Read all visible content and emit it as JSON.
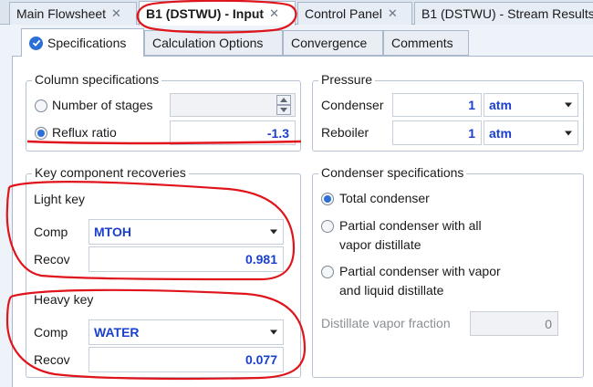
{
  "doc_tabs": [
    {
      "label": "Main Flowsheet",
      "active": false
    },
    {
      "label": "B1 (DSTWU) - Input",
      "active": true
    },
    {
      "label": "Control Panel",
      "active": false
    },
    {
      "label": "B1 (DSTWU) - Stream Results",
      "active": false
    }
  ],
  "close_glyph": "✕",
  "form_tabs": [
    {
      "label": "Specifications",
      "active": true,
      "icon": "check-circle-icon"
    },
    {
      "label": "Calculation Options",
      "active": false
    },
    {
      "label": "Convergence",
      "active": false
    },
    {
      "label": "Comments",
      "active": false
    }
  ],
  "column_specs": {
    "title": "Column specifications",
    "number_of_stages": {
      "label": "Number of stages",
      "selected": false,
      "value": ""
    },
    "reflux_ratio": {
      "label": "Reflux ratio",
      "selected": true,
      "value": "-1.3"
    }
  },
  "pressure": {
    "title": "Pressure",
    "condenser": {
      "label": "Condenser",
      "value": "1",
      "unit": "atm"
    },
    "reboiler": {
      "label": "Reboiler",
      "value": "1",
      "unit": "atm"
    }
  },
  "key_recoveries": {
    "title": "Key component recoveries",
    "light_key": {
      "title": "Light key",
      "comp_label": "Comp",
      "comp": "MTOH",
      "recov_label": "Recov",
      "recov": "0.981"
    },
    "heavy_key": {
      "title": "Heavy key",
      "comp_label": "Comp",
      "comp": "WATER",
      "recov_label": "Recov",
      "recov": "0.077"
    }
  },
  "condenser_specs": {
    "title": "Condenser specifications",
    "total": {
      "label": "Total condenser",
      "selected": true
    },
    "partial_vapor": {
      "line1": "Partial condenser with all",
      "line2": "vapor distillate",
      "selected": false
    },
    "partial_vapor_liquid": {
      "line1": "Partial condenser with vapor",
      "line2": "and liquid distillate",
      "selected": false
    },
    "distillate_vapor_fraction": {
      "label": "Distillate vapor fraction",
      "value": "0"
    }
  },
  "colors": {
    "accent": "#2c6fd6",
    "value_text": "#1a3fcf",
    "annotation": "#e0141b"
  }
}
